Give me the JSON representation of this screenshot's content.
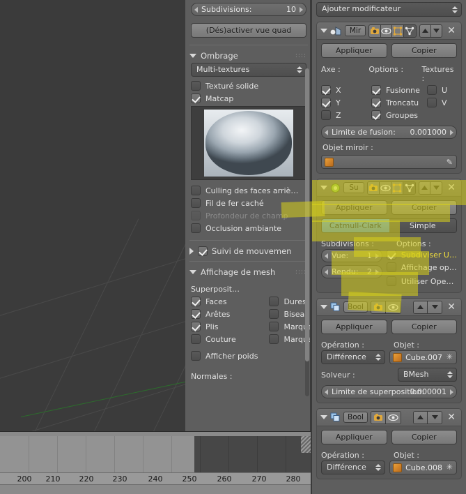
{
  "app": {
    "title": "Blender",
    "language": "fr"
  },
  "viewport": {
    "name": "3d-viewport",
    "background_color": "#3b3b3b",
    "grid_color": "#4a4a4a",
    "y_axis_color": "#2d6b2d"
  },
  "timeline": {
    "name": "timeline-editor",
    "ticks": [
      "200",
      "210",
      "220",
      "230",
      "240",
      "250",
      "260",
      "270",
      "280"
    ],
    "range_end_frame": "250"
  },
  "left_panel": {
    "subdivisions": {
      "label": "Subdivisions:",
      "value": "10"
    },
    "quad_view_button": "(Dés)activer vue quad",
    "shading": {
      "header": "Ombrage",
      "method": "Multi-textures",
      "options": [
        {
          "label": "Texturé solide",
          "checked": false
        },
        {
          "label": "Matcap",
          "checked": true
        }
      ],
      "matcap_preview": "matcap-sphere",
      "toggles": [
        {
          "label": "Culling des faces arriè…",
          "checked": false,
          "dim": false
        },
        {
          "label": "Fil de fer caché",
          "checked": false,
          "dim": false
        },
        {
          "label": "Profondeur de champ",
          "checked": false,
          "dim": true
        },
        {
          "label": "Occlusion ambiante",
          "checked": false,
          "dim": false
        }
      ]
    },
    "motion_tracking": {
      "label": "Suivi de mouvemen",
      "checked": true
    },
    "mesh_display": {
      "header": "Affichage de mesh",
      "overlays_label": "Superposit…",
      "left_column": [
        {
          "label": "Faces",
          "checked": true
        },
        {
          "label": "Arêtes",
          "checked": true
        },
        {
          "label": "Plis",
          "checked": true
        },
        {
          "label": "Couture",
          "checked": false
        },
        {
          "label": "Afficher poids",
          "checked": false
        }
      ],
      "right_column": [
        {
          "label": "Dures",
          "checked": false
        },
        {
          "label": "Biseau",
          "checked": false
        },
        {
          "label": "Marques",
          "checked": false
        },
        {
          "label": "Marques",
          "checked": false
        }
      ],
      "normals_label": "Normales  :"
    }
  },
  "right_panel": {
    "add_modifier": "Ajouter modificateur",
    "common": {
      "apply": "Appliquer",
      "copy": "Copier"
    },
    "modifiers": [
      {
        "id": "mirror",
        "name": "Mir",
        "icon": "mirror-icon",
        "highlighted": false,
        "column_headers": [
          "Axe  :",
          "Options  :",
          "Textures  :"
        ],
        "axis": [
          {
            "label": "X",
            "checked": true
          },
          {
            "label": "Y",
            "checked": true
          },
          {
            "label": "Z",
            "checked": false
          }
        ],
        "options": [
          {
            "label": "Fusionne",
            "checked": true
          },
          {
            "label": "Troncatu",
            "checked": true
          },
          {
            "label": "Groupes",
            "checked": true
          }
        ],
        "textures": [
          {
            "label": "U",
            "checked": false
          },
          {
            "label": "V",
            "checked": false
          }
        ],
        "merge_limit": {
          "label": "Limite de fusion:",
          "value": "0.001000"
        },
        "mirror_object_label": "Objet miroir  :",
        "mirror_object_value": ""
      },
      {
        "id": "subsurf",
        "name": "Su",
        "icon": "subsurf-icon",
        "highlighted": true,
        "algorithm_tabs": [
          {
            "label": "Catmull-Clark",
            "active": true
          },
          {
            "label": "Simple",
            "active": false
          }
        ],
        "column_headers": [
          "Subdivisions  :",
          "Options  :"
        ],
        "levels": [
          {
            "label": "Vue:",
            "value": "1"
          },
          {
            "label": "Rendu:",
            "value": "2"
          }
        ],
        "options": [
          {
            "label": "Subdiviser U…",
            "checked": true
          },
          {
            "label": "Affichage op…",
            "checked": false
          },
          {
            "label": "Utiliser Ope…",
            "checked": false
          }
        ]
      },
      {
        "id": "boolean-1",
        "name": "Bool",
        "icon": "boolean-icon",
        "highlighted": false,
        "operation_label": "Opération  :",
        "operation_value": "Différence",
        "object_label": "Objet  :",
        "object_value": "Cube.007",
        "solver_label": "Solveur  :",
        "solver_value": "BMesh",
        "overlap_threshold": {
          "label": "Limite de superposition:",
          "value": "0.000001"
        }
      },
      {
        "id": "boolean-2",
        "name": "Bool",
        "icon": "boolean-icon",
        "highlighted": false,
        "operation_label": "Opération  :",
        "operation_value": "Différence",
        "object_label": "Objet  :",
        "object_value": "Cube.008"
      }
    ]
  }
}
